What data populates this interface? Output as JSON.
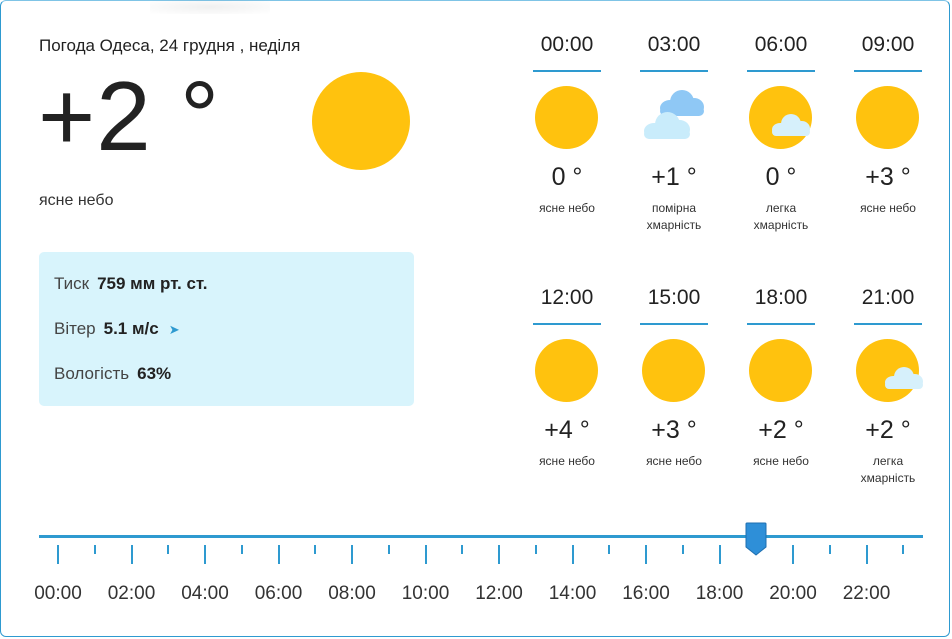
{
  "header": {
    "title": "Погода Одеса, 24 грудня , неділя"
  },
  "current": {
    "temp": "+2 °",
    "description": "ясне небо",
    "icon": "sun-icon"
  },
  "details": {
    "pressure_label": "Тиск",
    "pressure_value": "759 мм рт. ст.",
    "wind_label": "Вітер",
    "wind_value": "5.1 м/с",
    "wind_arrow": "➤",
    "humidity_label": "Вологість",
    "humidity_value": "63%"
  },
  "hours": [
    {
      "time": "00:00",
      "temp": "0 °",
      "desc": "ясне небо",
      "icon": "sun-icon"
    },
    {
      "time": "03:00",
      "temp": "+1 °",
      "desc": "помірна хмарність",
      "icon": "clouds-icon"
    },
    {
      "time": "06:00",
      "temp": "0 °",
      "desc": "легка хмарність",
      "icon": "sun-cloud-icon"
    },
    {
      "time": "09:00",
      "temp": "+3 °",
      "desc": "ясне небо",
      "icon": "sun-icon"
    },
    {
      "time": "12:00",
      "temp": "+4 °",
      "desc": "ясне небо",
      "icon": "sun-icon"
    },
    {
      "time": "15:00",
      "temp": "+3 °",
      "desc": "ясне небо",
      "icon": "sun-icon"
    },
    {
      "time": "18:00",
      "temp": "+2 °",
      "desc": "ясне небо",
      "icon": "sun-icon"
    },
    {
      "time": "21:00",
      "temp": "+2 °",
      "desc": "легка хмарність",
      "icon": "sun-cloud-icon"
    }
  ],
  "timeline": {
    "labels": [
      "00:00",
      "02:00",
      "04:00",
      "06:00",
      "08:00",
      "10:00",
      "12:00",
      "14:00",
      "16:00",
      "18:00",
      "20:00",
      "22:00"
    ],
    "selected_hour": 19
  },
  "colors": {
    "accent": "#2e9ad0",
    "sun": "#ffc20e",
    "info_bg": "#d8f4fc"
  }
}
